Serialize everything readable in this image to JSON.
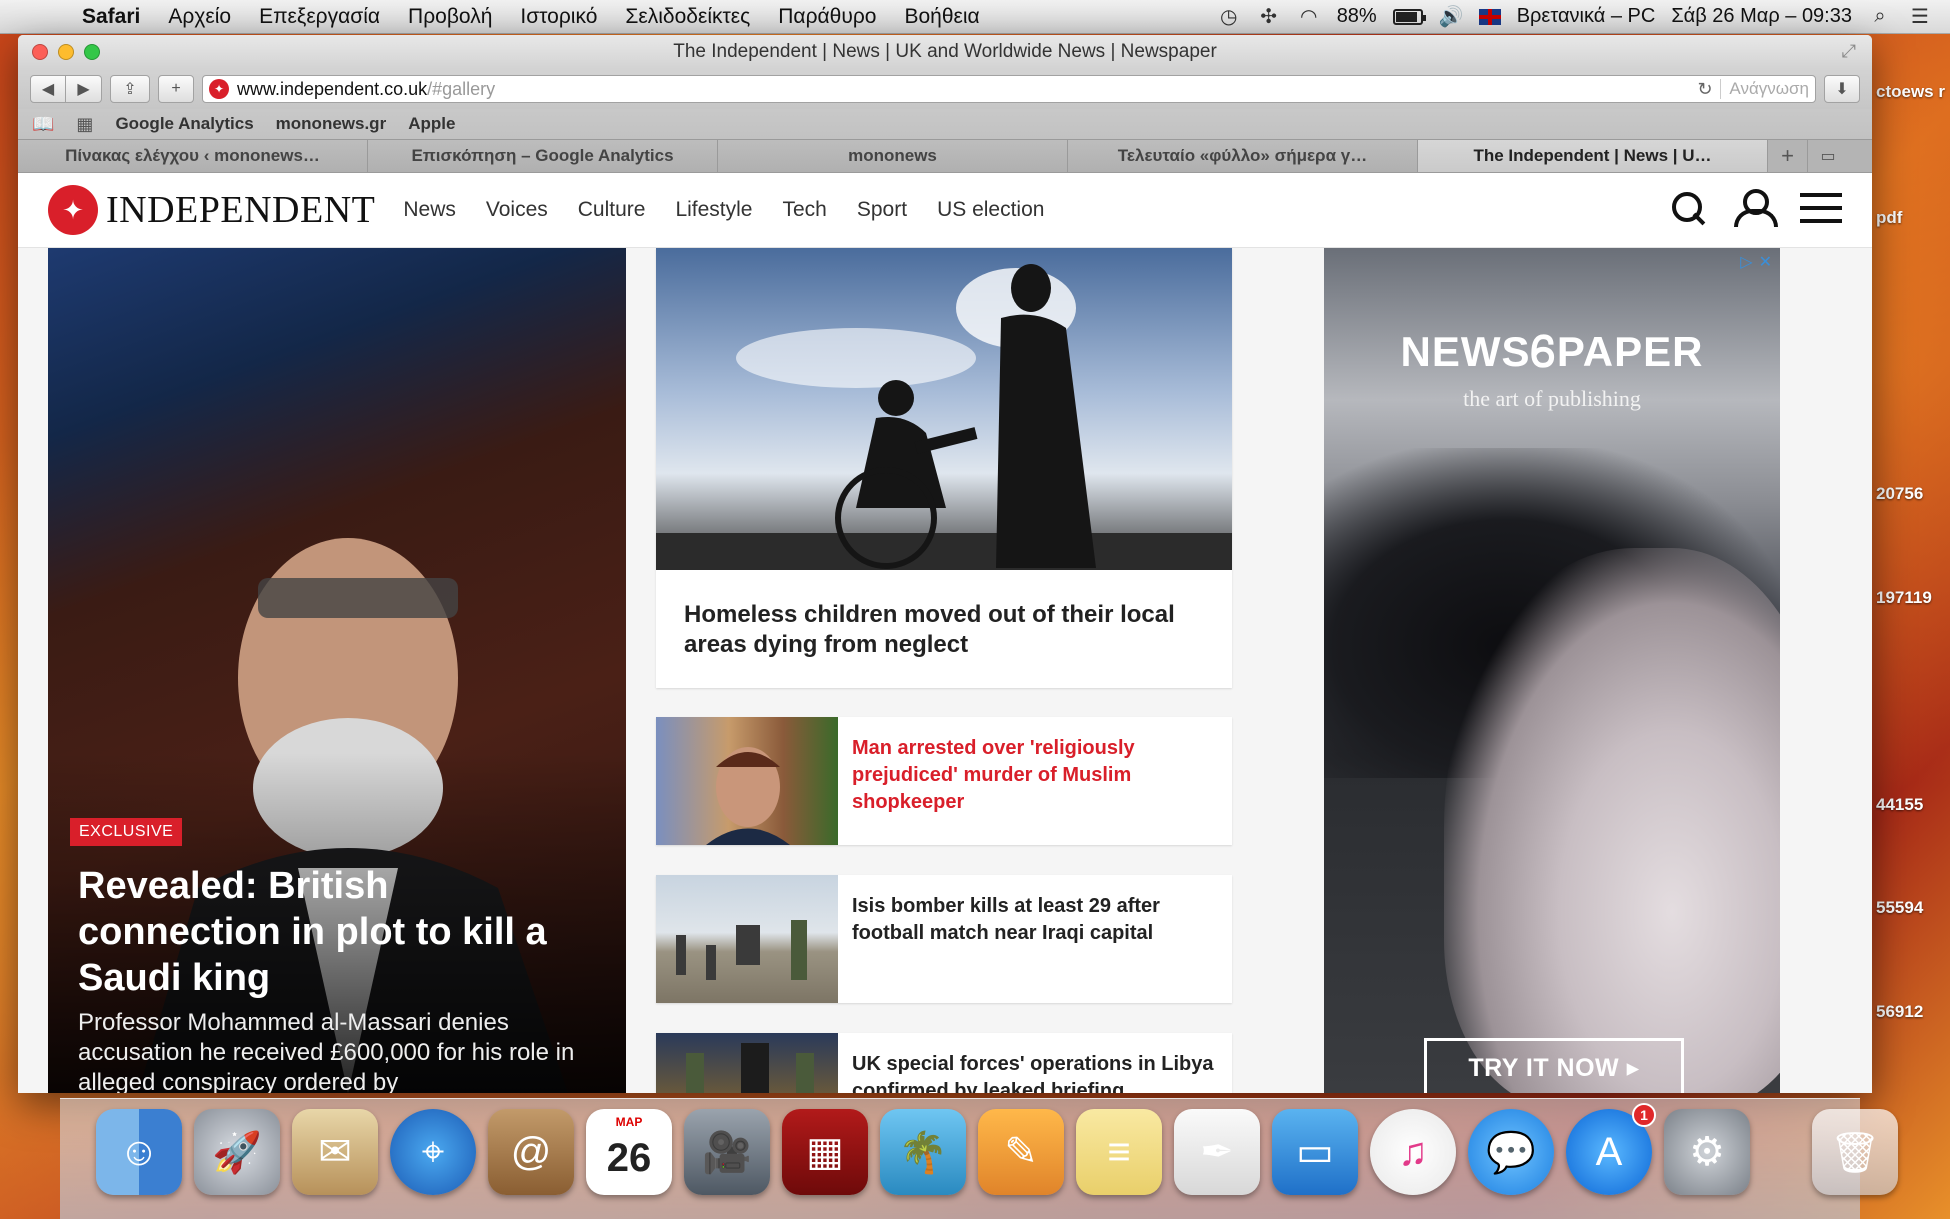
{
  "menubar": {
    "app": "Safari",
    "items": [
      "Αρχείο",
      "Επεξεργασία",
      "Προβολή",
      "Ιστορικό",
      "Σελιδοδείκτες",
      "Παράθυρο",
      "Βοήθεια"
    ],
    "battery": "88%",
    "battery_level": 0.88,
    "input_source": "Βρετανικά – PC",
    "clock": "Σάβ 26 Μαρ – 09:33"
  },
  "window": {
    "title": "The Independent | News | UK and Worldwide News | Newspaper",
    "url_host": "www.independent.co.uk",
    "url_path": "/#gallery",
    "reader_label": "Ανάγνωση"
  },
  "bookmarks": [
    "Google Analytics",
    "mononews.gr",
    "Apple"
  ],
  "tabs": [
    {
      "label": "Πίνακας ελέγχου ‹ mononews…"
    },
    {
      "label": "Επισκόπηση – Google Analytics"
    },
    {
      "label": "mononews"
    },
    {
      "label": "Τελευταίο «φύλλο» σήμερα γ…"
    },
    {
      "label": "The Independent | News | U…"
    }
  ],
  "site": {
    "logo_text": "INDEPENDENT",
    "nav": [
      "News",
      "Voices",
      "Culture",
      "Lifestyle",
      "Tech",
      "Sport",
      "US election"
    ]
  },
  "lead": {
    "badge": "EXCLUSIVE",
    "headline": "Revealed: British connection in plot to kill a Saudi king",
    "standfirst": "Professor Mohammed al-Massari denies accusation he received £600,000 for his role in alleged conspiracy ordered by"
  },
  "stories": {
    "big": "Homeless children moved out of their local areas dying from neglect",
    "s1": "Man arrested over 'religiously prejudiced' murder of Muslim shopkeeper",
    "s2": "Isis bomber kills at least 29 after football match near Iraqi capital",
    "s3": "UK special forces' operations in Libya confirmed by leaked briefing"
  },
  "ad": {
    "brand_left": "NEWS",
    "brand_right": "PAPER",
    "tagline": "the art of publishing",
    "cta": "TRY IT NOW"
  },
  "desktop_labels": [
    "ctoews r",
    "pdf",
    "20756",
    "197119",
    "44155",
    "55594",
    "56912"
  ],
  "dock": {
    "calendar_month": "MAP",
    "calendar_day": "26",
    "appstore_badge": "1"
  },
  "colors": {
    "independent_red": "#d91f2a",
    "menubar": "#e6e6e6"
  }
}
